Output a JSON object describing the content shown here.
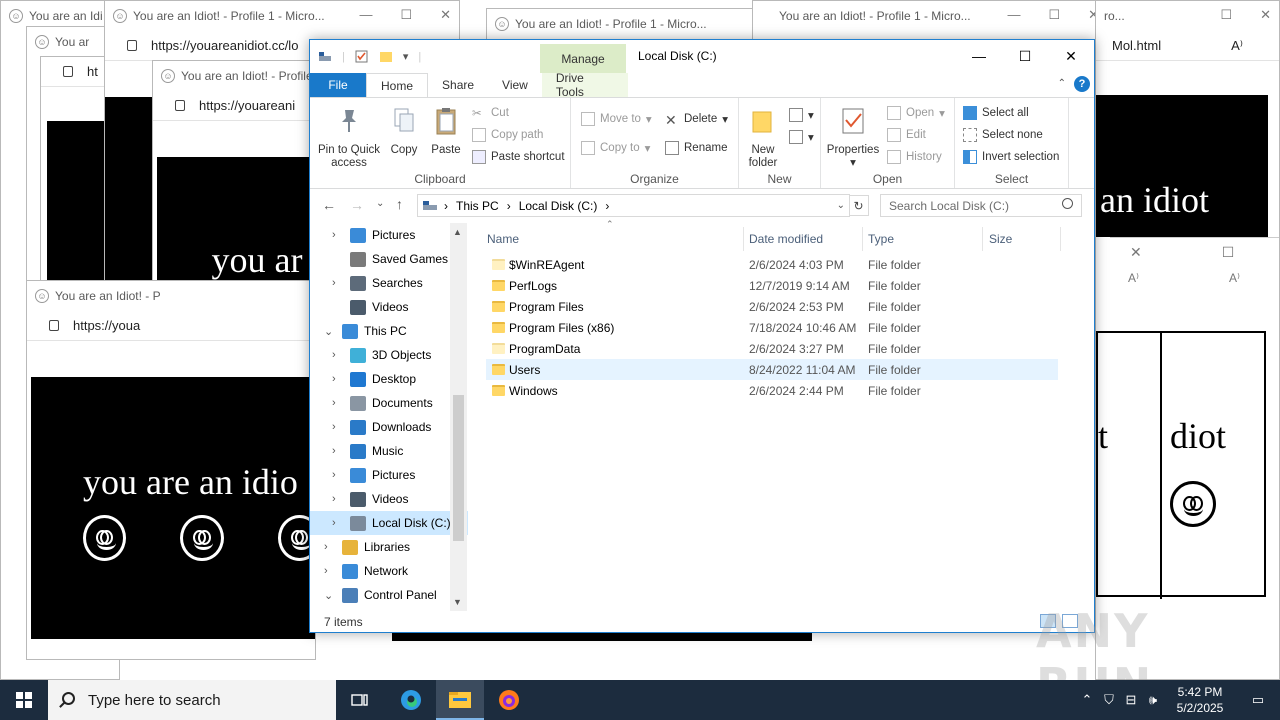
{
  "background": {
    "tab_title": "You are an Idiot! - Profile 1 - Micro...",
    "tab_title_short1": "You are an Idi",
    "tab_title_short2": "You ar",
    "tab_title_short3": "You are an Idiot! - Profile",
    "tab_title_short4": "You are an Idiot! - P",
    "tab_title_right": "ro...",
    "url_full": "https://youareanidiot.cc/lo",
    "url_mid": "https://youareani",
    "url_short": "https://youa",
    "url_tiny": "ht",
    "url_right": "Mol.html",
    "idiot_text": "you are an idiot",
    "idiot_text_cut1": "you ar",
    "idiot_text_cut2": "you are an idio",
    "idiot_text_right": "an idiot",
    "idiot_text_right2": "diot",
    "idiot_text_right3": "ot"
  },
  "explorer": {
    "window_title": "Local Disk (C:)",
    "context_tab": "Manage",
    "context_sub": "Drive Tools",
    "tabs": [
      "File",
      "Home",
      "Share",
      "View"
    ],
    "ribbon": {
      "clipboard": {
        "label": "Clipboard",
        "pin": "Pin to Quick access",
        "copy": "Copy",
        "paste": "Paste",
        "cut": "Cut",
        "copy_path": "Copy path",
        "paste_shortcut": "Paste shortcut"
      },
      "organize": {
        "label": "Organize",
        "move_to": "Move to",
        "copy_to": "Copy to",
        "delete": "Delete",
        "rename": "Rename"
      },
      "new": {
        "label": "New",
        "new_folder": "New folder"
      },
      "open": {
        "label": "Open",
        "properties": "Properties",
        "open": "Open",
        "edit": "Edit",
        "history": "History"
      },
      "select": {
        "label": "Select",
        "select_all": "Select all",
        "select_none": "Select none",
        "invert": "Invert selection"
      }
    },
    "breadcrumb": [
      "This PC",
      "Local Disk (C:)"
    ],
    "search_placeholder": "Search Local Disk (C:)",
    "nav": [
      {
        "label": "Pictures",
        "indent": 1,
        "chev": "›",
        "icon": "pictures-icon"
      },
      {
        "label": "Saved Games",
        "indent": 1,
        "chev": "",
        "icon": "saved-games-icon"
      },
      {
        "label": "Searches",
        "indent": 1,
        "chev": "›",
        "icon": "searches-icon"
      },
      {
        "label": "Videos",
        "indent": 1,
        "chev": "",
        "icon": "videos-icon"
      },
      {
        "label": "This PC",
        "indent": 0,
        "chev": "⌄",
        "icon": "this-pc-icon"
      },
      {
        "label": "3D Objects",
        "indent": 1,
        "chev": "›",
        "icon": "3d-objects-icon"
      },
      {
        "label": "Desktop",
        "indent": 1,
        "chev": "›",
        "icon": "desktop-icon"
      },
      {
        "label": "Documents",
        "indent": 1,
        "chev": "›",
        "icon": "documents-icon"
      },
      {
        "label": "Downloads",
        "indent": 1,
        "chev": "›",
        "icon": "downloads-icon"
      },
      {
        "label": "Music",
        "indent": 1,
        "chev": "›",
        "icon": "music-icon"
      },
      {
        "label": "Pictures",
        "indent": 1,
        "chev": "›",
        "icon": "pictures-icon"
      },
      {
        "label": "Videos",
        "indent": 1,
        "chev": "›",
        "icon": "videos-icon"
      },
      {
        "label": "Local Disk (C:)",
        "indent": 1,
        "chev": "›",
        "icon": "drive-icon",
        "selected": true
      },
      {
        "label": "Libraries",
        "indent": 0,
        "chev": "›",
        "icon": "libraries-icon"
      },
      {
        "label": "Network",
        "indent": 0,
        "chev": "›",
        "icon": "network-icon"
      },
      {
        "label": "Control Panel",
        "indent": 0,
        "chev": "⌄",
        "icon": "control-panel-icon"
      }
    ],
    "columns": [
      "Name",
      "Date modified",
      "Type",
      "Size"
    ],
    "files": [
      {
        "name": "$WinREAgent",
        "date": "2/6/2024 4:03 PM",
        "type": "File folder",
        "hidden": true
      },
      {
        "name": "PerfLogs",
        "date": "12/7/2019 9:14 AM",
        "type": "File folder"
      },
      {
        "name": "Program Files",
        "date": "2/6/2024 2:53 PM",
        "type": "File folder"
      },
      {
        "name": "Program Files (x86)",
        "date": "7/18/2024 10:46 AM",
        "type": "File folder"
      },
      {
        "name": "ProgramData",
        "date": "2/6/2024 3:27 PM",
        "type": "File folder",
        "hidden": true
      },
      {
        "name": "Users",
        "date": "8/24/2022 11:04 AM",
        "type": "File folder",
        "selected": true
      },
      {
        "name": "Windows",
        "date": "2/6/2024 2:44 PM",
        "type": "File folder"
      }
    ],
    "status": "7 items"
  },
  "taskbar": {
    "search_placeholder": "Type here to search",
    "time": "5:42 PM",
    "date": "5/2/2025",
    "watermark": "ANY RUN"
  }
}
